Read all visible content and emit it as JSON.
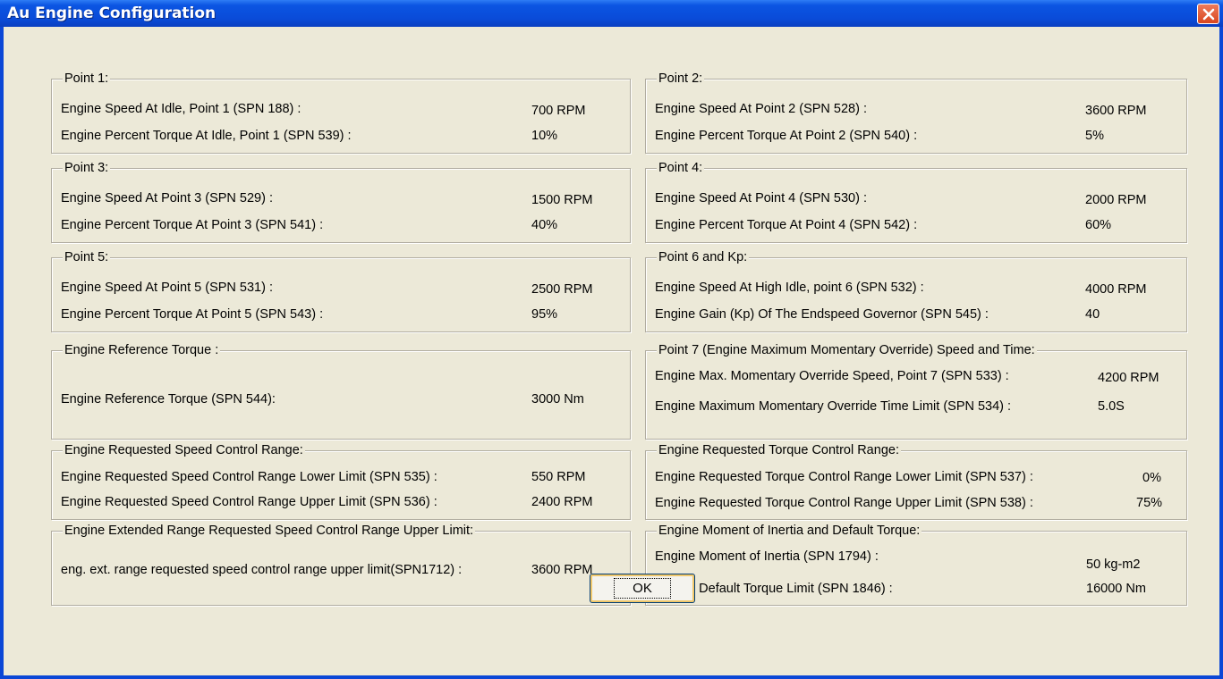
{
  "window": {
    "title": "Au Engine Configuration"
  },
  "groups": [
    {
      "legend": "Point 1:",
      "rows": [
        {
          "label": "Engine Speed At Idle, Point 1 (SPN 188) :",
          "value": "700 RPM"
        },
        {
          "label": "Engine Percent Torque At Idle, Point 1 (SPN 539) :",
          "value": "10%"
        }
      ]
    },
    {
      "legend": "Point 2:",
      "rows": [
        {
          "label": "Engine Speed At Point 2 (SPN 528) :",
          "value": "3600 RPM"
        },
        {
          "label": "Engine Percent Torque At Point 2 (SPN 540) :",
          "value": "5%"
        }
      ]
    },
    {
      "legend": "Point 3:",
      "rows": [
        {
          "label": "Engine Speed At Point 3 (SPN 529) :",
          "value": "1500 RPM"
        },
        {
          "label": "Engine Percent Torque At Point 3 (SPN 541) :",
          "value": "40%"
        }
      ]
    },
    {
      "legend": "Point 4:",
      "rows": [
        {
          "label": "Engine Speed At Point 4 (SPN 530) :",
          "value": "2000 RPM"
        },
        {
          "label": "Engine Percent Torque At Point 4 (SPN 542) :",
          "value": "60%"
        }
      ]
    },
    {
      "legend": "Point 5:",
      "rows": [
        {
          "label": "Engine Speed At Point 5 (SPN 531) :",
          "value": "2500 RPM"
        },
        {
          "label": "Engine Percent Torque At Point 5 (SPN 543) :",
          "value": "95%"
        }
      ]
    },
    {
      "legend": "Point 6 and Kp:",
      "rows": [
        {
          "label": "Engine Speed At High Idle, point 6 (SPN 532) :",
          "value": "4000 RPM"
        },
        {
          "label": "Engine Gain (Kp) Of The Endspeed Governor (SPN 545) :",
          "value": "40"
        }
      ]
    },
    {
      "legend": "Engine Reference Torque :",
      "rows": [
        {
          "label": "Engine Reference Torque (SPN 544):",
          "value": "3000 Nm"
        }
      ]
    },
    {
      "legend": "Point 7 (Engine Maximum Momentary Override) Speed and Time:",
      "rows": [
        {
          "label": "Engine Max. Momentary Override Speed, Point 7 (SPN 533) :",
          "value": "4200 RPM"
        },
        {
          "label": "Engine Maximum Momentary Override Time Limit (SPN 534) :",
          "value": "5.0S"
        }
      ]
    },
    {
      "legend": "Engine Requested Speed Control Range:",
      "rows": [
        {
          "label": "Engine Requested Speed Control Range Lower Limit (SPN 535) :",
          "value": "550 RPM"
        },
        {
          "label": "Engine Requested Speed Control Range Upper Limit  (SPN 536) :",
          "value": "2400 RPM"
        }
      ]
    },
    {
      "legend": "Engine Requested Torque Control Range:",
      "rows": [
        {
          "label": "Engine Requested Torque Control Range Lower Limit (SPN 537) :",
          "value": "0%"
        },
        {
          "label": "Engine Requested Torque Control Range Upper Limit (SPN 538) :",
          "value": "75%"
        }
      ]
    },
    {
      "legend": "Engine Extended Range Requested Speed Control Range Upper Limit:",
      "rows": [
        {
          "label": "eng. ext. range requested speed control range upper limit(SPN1712) :",
          "value": "3600 RPM"
        }
      ]
    },
    {
      "legend": "Engine Moment of Inertia and Default Torque:",
      "rows": [
        {
          "label": "Engine Moment of Inertia (SPN 1794) :",
          "value": "50 kg-m2"
        },
        {
          "label": "Engine Default Torque Limit (SPN 1846) :",
          "value": "16000 Nm"
        }
      ]
    }
  ],
  "ok_button": {
    "label": "OK"
  }
}
